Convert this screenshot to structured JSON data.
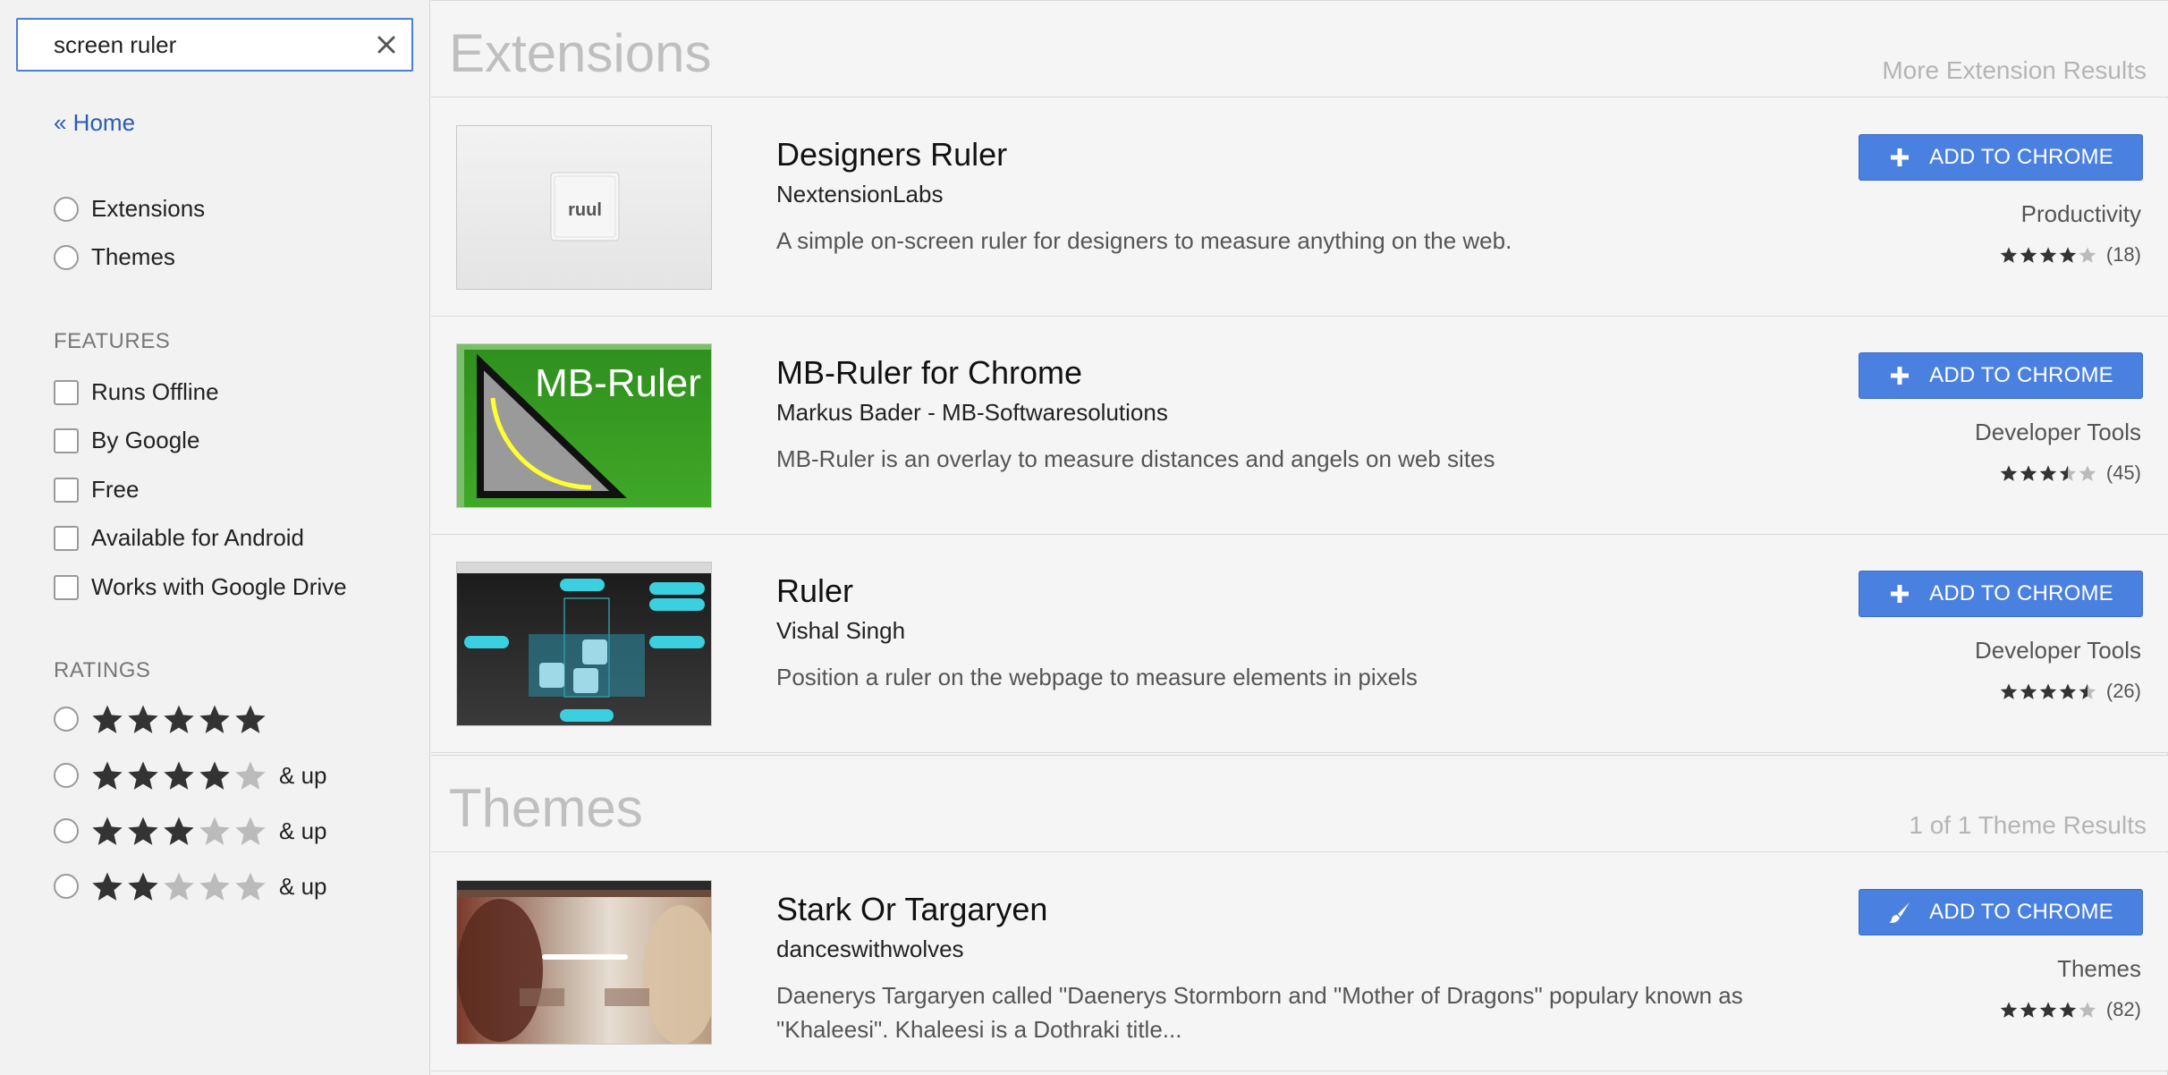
{
  "search": {
    "value": "screen ruler"
  },
  "sidebar": {
    "home_link": "« Home",
    "type_options": [
      {
        "label": "Extensions"
      },
      {
        "label": "Themes"
      }
    ],
    "features_heading": "FEATURES",
    "features": [
      {
        "label": "Runs Offline"
      },
      {
        "label": "By Google"
      },
      {
        "label": "Free"
      },
      {
        "label": "Available for Android"
      },
      {
        "label": "Works with Google Drive"
      }
    ],
    "ratings_heading": "RATINGS",
    "ratings": [
      {
        "stars": 5,
        "suffix": ""
      },
      {
        "stars": 4,
        "suffix": "& up"
      },
      {
        "stars": 3,
        "suffix": "& up"
      },
      {
        "stars": 2,
        "suffix": "& up"
      }
    ]
  },
  "extensions": {
    "title": "Extensions",
    "more": "More Extension Results",
    "items": [
      {
        "name": "Designers Ruler",
        "author": "NextensionLabs",
        "description": "A simple on-screen ruler for designers to measure anything on the web.",
        "button": "ADD TO CHROME",
        "category": "Productivity",
        "rating": 4,
        "count": "(18)",
        "thumb_text": "ruul"
      },
      {
        "name": "MB-Ruler for Chrome",
        "author": "Markus Bader - MB-Softwaresolutions",
        "description": "MB-Ruler is an overlay to measure distances and angels on web sites",
        "button": "ADD TO CHROME",
        "category": "Developer Tools",
        "rating": 3.5,
        "count": "(45)",
        "thumb_text": "MB-Ruler"
      },
      {
        "name": "Ruler",
        "author": "Vishal Singh",
        "description": "Position a ruler on the webpage to measure elements in pixels",
        "button": "ADD TO CHROME",
        "category": "Developer Tools",
        "rating": 4.5,
        "count": "(26)"
      }
    ]
  },
  "themes": {
    "title": "Themes",
    "more": "1 of 1 Theme Results",
    "items": [
      {
        "name": "Stark Or Targaryen",
        "author": "danceswithwolves",
        "description": "Daenerys Targaryen called \"Daenerys Stormborn and \"Mother of Dragons\" populary known as \"Khaleesi\". Khaleesi is a Dothraki title...",
        "button": "ADD TO CHROME",
        "category": "Themes",
        "rating": 4,
        "count": "(82)"
      }
    ]
  },
  "colors": {
    "accent": "#4a80e0",
    "link": "#2a5bb8",
    "star_filled": "#333333",
    "star_empty": "#bbbbbb"
  }
}
